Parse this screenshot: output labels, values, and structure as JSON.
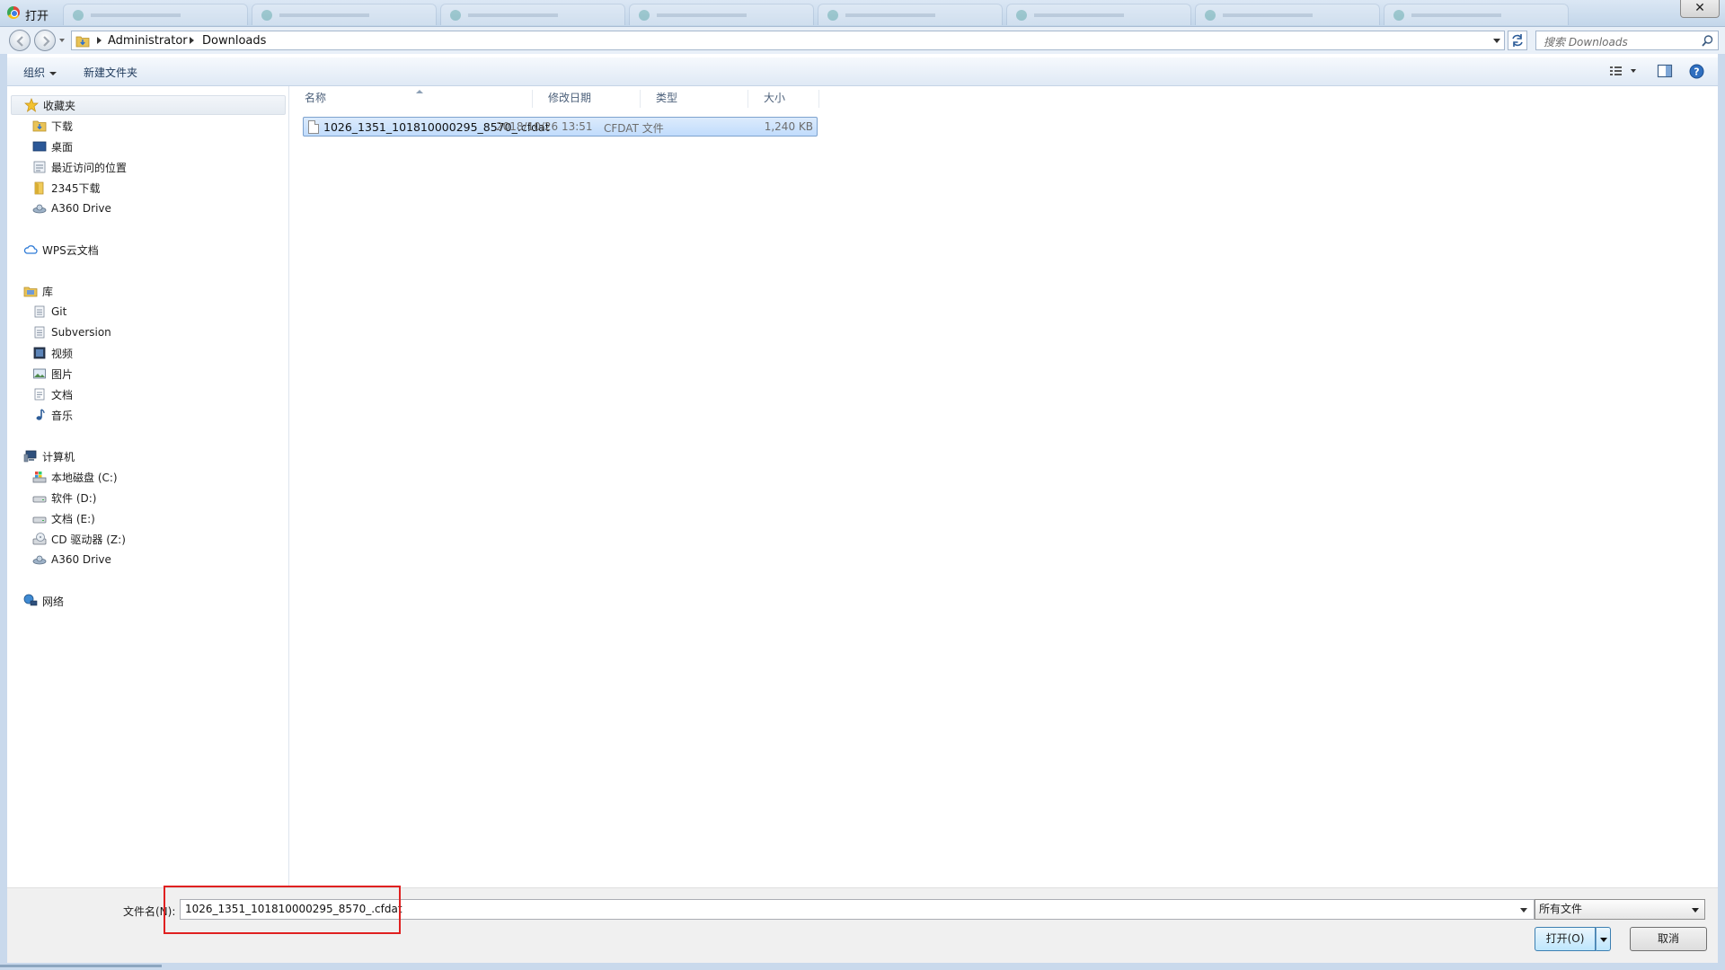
{
  "window": {
    "title": "打开",
    "close_label": "✕"
  },
  "address": {
    "crumbs": [
      "Administrator",
      "Downloads"
    ]
  },
  "search": {
    "placeholder": "搜索 Downloads"
  },
  "toolbar": {
    "organize_label": "组织",
    "new_folder_label": "新建文件夹"
  },
  "sidebar": {
    "favorites": {
      "label": "收藏夹",
      "items": [
        "下载",
        "桌面",
        "最近访问的位置",
        "2345下载",
        "A360 Drive"
      ]
    },
    "wps": {
      "label": "WPS云文档"
    },
    "libraries": {
      "label": "库",
      "items": [
        "Git",
        "Subversion",
        "视频",
        "图片",
        "文档",
        "音乐"
      ]
    },
    "computer": {
      "label": "计算机",
      "items": [
        "本地磁盘 (C:)",
        "软件 (D:)",
        "文档 (E:)",
        "CD 驱动器 (Z:)",
        "A360 Drive"
      ]
    },
    "network": {
      "label": "网络"
    }
  },
  "columns": {
    "name": "名称",
    "date": "修改日期",
    "type": "类型",
    "size": "大小"
  },
  "files": [
    {
      "name": "1026_1351_101810000295_8570_.cfdat",
      "date": "2018/10/26 13:51",
      "type": "CFDAT 文件",
      "size": "1,240 KB"
    }
  ],
  "bottom": {
    "filename_label": "文件名(N):",
    "filename_value": "1026_1351_101810000295_8570_.cfdat",
    "filter_value": "所有文件",
    "open_label": "打开(O)",
    "cancel_label": "取消"
  },
  "colors": {
    "selection": "#cce4fc",
    "highlight_box": "#e02020",
    "toolbar_text": "#1e395b"
  }
}
